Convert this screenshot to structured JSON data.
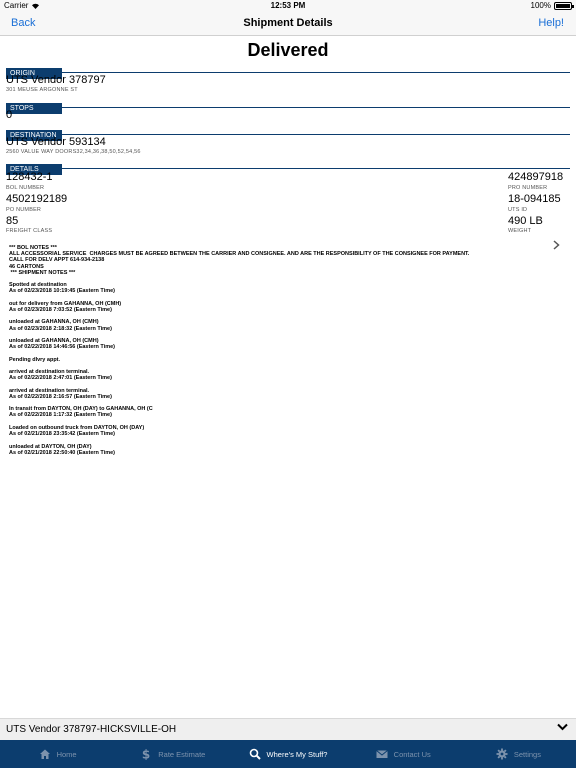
{
  "status_bar": {
    "carrier": "Carrier",
    "time": "12:53 PM",
    "battery": "100%"
  },
  "nav": {
    "back_label": "Back",
    "title": "Shipment Details",
    "help_label": "Help!"
  },
  "status": "Delivered",
  "origin": {
    "header": "ORIGIN",
    "name": "UTS Vendor 378797",
    "address": "301 MEUSE ARGONNE ST"
  },
  "stops": {
    "header": "STOPS",
    "value": "0"
  },
  "destination": {
    "header": "DESTINATION",
    "name": "UTS Vendor 593134",
    "address": "2560 VALUE WAY DOORS32,34,36,38,50,52,54,56"
  },
  "details": {
    "header": "DETAILS",
    "bol_number": {
      "value": "128432-1",
      "label": "BOL NUMBER"
    },
    "pro_number": {
      "value": "424897918",
      "label": "PRO NUMBER"
    },
    "po_number": {
      "value": "4502192189",
      "label": "PO NUMBER"
    },
    "uts_id": {
      "value": "18-094185",
      "label": "UTS ID"
    },
    "freight_class": {
      "value": "85",
      "label": "FREIGHT CLASS"
    },
    "weight": {
      "value": "490 LB",
      "label": "WEIGHT"
    }
  },
  "notes": "*** BOL NOTES ***\nALL ACCESSORIAL SERVICE  CHARGES MUST BE AGREED BETWEEN THE CARRIER AND CONSIGNEE. AND ARE THE RESPONSIBILITY OF THE CONSIGNEE FOR PAYMENT.\nCALL FOR DELV APPT 614-934-2138\n46 CARTONS\n *** SHIPMENT NOTES ***\n\nSpotted at destination\nAs of 02/23/2018 10:19:45 (Eastern Time)\n\nout for delivery from GAHANNA, OH (CMH)\nAs of 02/23/2018 7:03:52 (Eastern Time)\n\nunloaded at GAHANNA, OH (CMH)\nAs of 02/23/2018 2:18:32 (Eastern Time)\n\nunloaded at GAHANNA, OH (CMH)\nAs of 02/22/2018 14:46:56 (Eastern Time)\n\nPending dlvry appt.\n\narrived at destination terminal.\nAs of 02/22/2018 2:47:01 (Eastern Time)\n\narrived at destination terminal.\nAs of 02/22/2018 2:16:57 (Eastern Time)\n\nIn transit from DAYTON, OH (DAY) to GAHANNA, OH (C\nAs of 02/22/2018 1:17:32 (Eastern Time)\n\nLoaded on outbound truck from DAYTON, OH (DAY)\nAs of 02/21/2018 23:35:42 (Eastern Time)\n\nunloaded at DAYTON, OH (DAY)\nAs of 02/21/2018 22:50:40 (Eastern Time)",
  "picker": {
    "selected": "UTS Vendor 378797-HICKSVILLE-OH"
  },
  "tabs": [
    {
      "label": "Home",
      "icon": "home-icon"
    },
    {
      "label": "Rate Estimate",
      "icon": "dollar-icon"
    },
    {
      "label": "Where's My Stuff?",
      "icon": "search-icon"
    },
    {
      "label": "Contact Us",
      "icon": "mail-icon"
    },
    {
      "label": "Settings",
      "icon": "gear-icon"
    }
  ],
  "colors": {
    "accent": "#0c3d6e",
    "link": "#1a6fd6",
    "tab_inactive": "#7d93ad"
  }
}
